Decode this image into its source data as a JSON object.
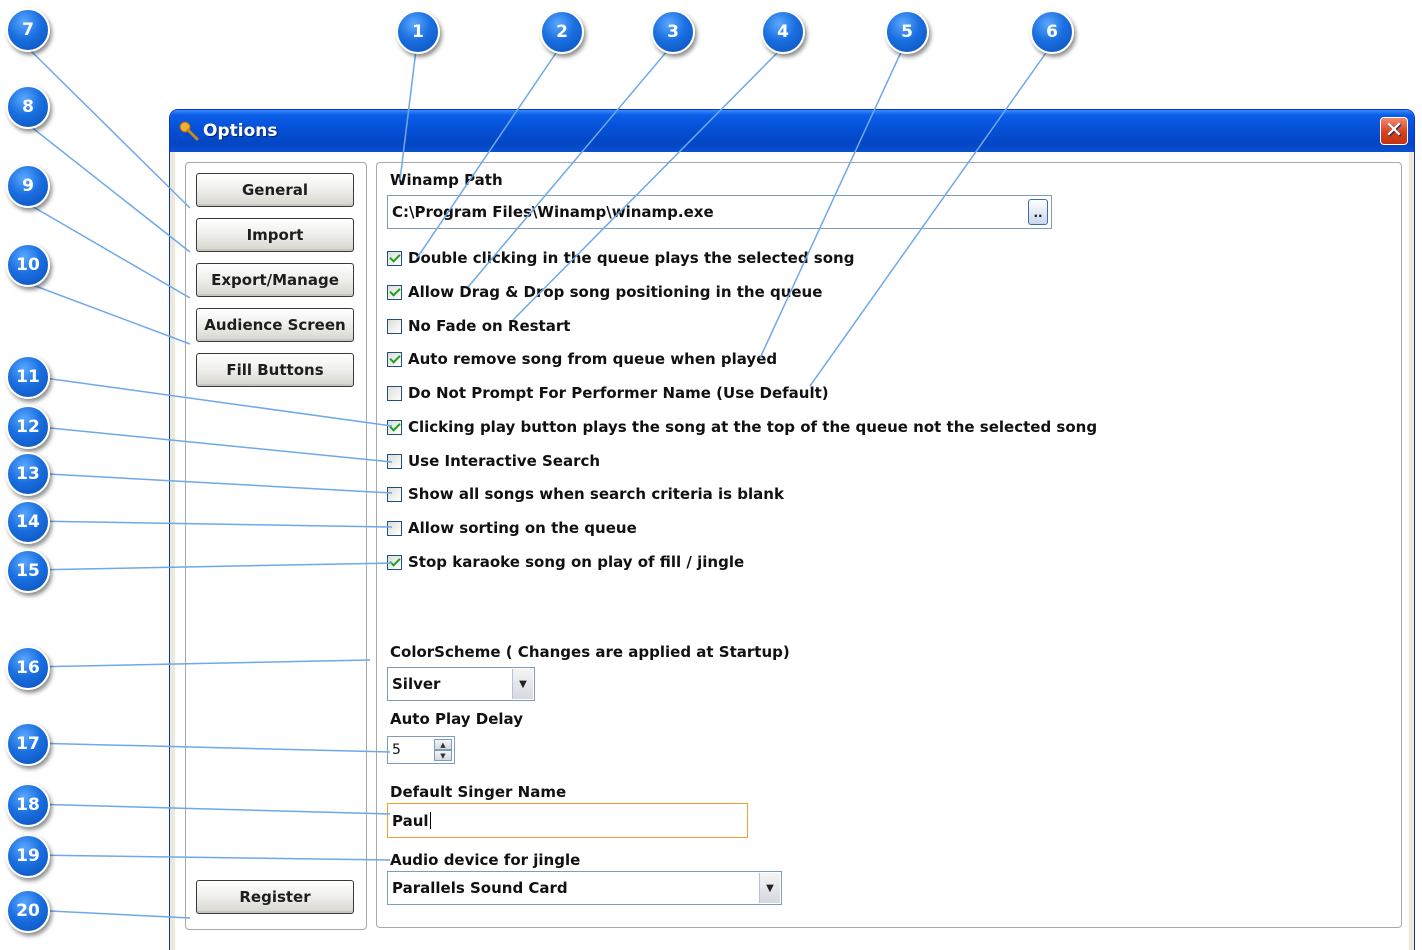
{
  "window": {
    "title": "Options",
    "close_glyph": "✕"
  },
  "nav": {
    "general": "General",
    "import": "Import",
    "export_manage": "Export/Manage",
    "audience_screen": "Audience Screen",
    "fill_buttons": "Fill Buttons",
    "register": "Register"
  },
  "winamp": {
    "label": "Winamp Path",
    "value": "C:\\Program Files\\Winamp\\winamp.exe",
    "browse_label": ".."
  },
  "options": [
    {
      "label": "Double clicking in the queue plays the selected song",
      "checked": true
    },
    {
      "label": "Allow Drag & Drop song positioning in the queue",
      "checked": true
    },
    {
      "label": "No Fade on Restart",
      "checked": false
    },
    {
      "label": "Auto remove song from queue when played",
      "checked": true
    },
    {
      "label": "Do Not  Prompt For Performer Name (Use Default)",
      "checked": false
    },
    {
      "label": "Clicking play button plays the song at the top of the queue not the selected song",
      "checked": true
    },
    {
      "label": "Use Interactive Search",
      "checked": false
    },
    {
      "label": "Show all songs when search criteria is blank",
      "checked": false
    },
    {
      "label": "Allow sorting on the queue",
      "checked": false
    },
    {
      "label": "Stop karaoke song on play of fill / jingle",
      "checked": true
    }
  ],
  "color_scheme": {
    "label": "ColorScheme ( Changes are applied at Startup)",
    "value": "Silver"
  },
  "auto_play_delay": {
    "label": "Auto Play Delay",
    "value": "5"
  },
  "default_singer": {
    "label": "Default Singer Name",
    "value": "Paul"
  },
  "audio_device": {
    "label": "Audio device for jingle",
    "value": "Parallels Sound Card"
  },
  "callouts": [
    "1",
    "2",
    "3",
    "4",
    "5",
    "6",
    "7",
    "8",
    "9",
    "10",
    "11",
    "12",
    "13",
    "14",
    "15",
    "16",
    "17",
    "18",
    "19",
    "20"
  ],
  "colors": {
    "callout": "#1a6fe0",
    "leader_line": "#6fa8e8",
    "titlebar": "#0550d6",
    "focus_border": "#f0a030"
  }
}
